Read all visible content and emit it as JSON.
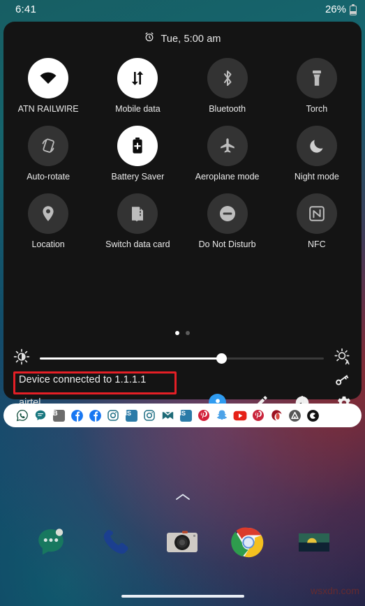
{
  "status_bar": {
    "time": "6:41",
    "battery_percent": "26%",
    "battery_icon": "battery-low-icon"
  },
  "quick_settings": {
    "alarm_icon": "alarm-clock-icon",
    "alarm_text": "Tue, 5:00 am",
    "tiles": [
      {
        "label": "ATN RAILWIRE",
        "icon": "wifi-icon",
        "active": true
      },
      {
        "label": "Mobile data",
        "icon": "mobile-data-icon",
        "active": true
      },
      {
        "label": "Bluetooth",
        "icon": "bluetooth-icon",
        "active": false
      },
      {
        "label": "Torch",
        "icon": "flashlight-icon",
        "active": false
      },
      {
        "label": "Auto-rotate",
        "icon": "auto-rotate-icon",
        "active": false
      },
      {
        "label": "Battery Saver",
        "icon": "battery-saver-icon",
        "active": true
      },
      {
        "label": "Aeroplane mode",
        "icon": "airplane-icon",
        "active": false
      },
      {
        "label": "Night mode",
        "icon": "moon-icon",
        "active": false
      },
      {
        "label": "Location",
        "icon": "location-pin-icon",
        "active": false
      },
      {
        "label": "Switch data card",
        "icon": "sim-card-icon",
        "active": false
      },
      {
        "label": "Do Not Disturb",
        "icon": "do-not-disturb-icon",
        "active": false
      },
      {
        "label": "NFC",
        "icon": "nfc-icon",
        "active": false
      }
    ],
    "pages": {
      "count": 2,
      "active_index": 0
    },
    "brightness": {
      "low_icon": "brightness-low-icon",
      "auto_icon": "brightness-auto-icon",
      "value_percent": 64
    },
    "footer": {
      "vpn_icon": "vpn-key-icon",
      "network_status": "Device connected to 1.1.1.1",
      "carrier": "airtel",
      "icons": [
        {
          "name": "user-avatar-icon",
          "label": "User"
        },
        {
          "name": "edit-pencil-icon",
          "label": "Edit"
        },
        {
          "name": "power-icon",
          "label": "Power"
        },
        {
          "name": "settings-gear-icon",
          "label": "Settings"
        }
      ]
    },
    "annotation": {
      "color": "#e41f26",
      "target": "Device connected to 1.1.1.1"
    }
  },
  "notification_strip": {
    "apps": [
      {
        "name": "whatsapp-icon",
        "color": "#0f4c3a"
      },
      {
        "name": "message-icon",
        "color": "#19777f"
      },
      {
        "name": "b-app-icon",
        "color": "#6b6b6b",
        "letter": "B"
      },
      {
        "name": "facebook-icon",
        "color": "#1877f2"
      },
      {
        "name": "facebook-icon-2",
        "color": "#1877f2"
      },
      {
        "name": "instagram-icon",
        "color": "#1f6f84"
      },
      {
        "name": "is-app-icon",
        "color": "#2b7ba8",
        "letter": "IS"
      },
      {
        "name": "instagram-icon-2",
        "color": "#1f6f84"
      },
      {
        "name": "mail-check-icon",
        "color": "#1f6b78"
      },
      {
        "name": "is-app-icon-2",
        "color": "#2b7ba8",
        "letter": "IS"
      },
      {
        "name": "pinterest-icon",
        "color": "#d3203a"
      },
      {
        "name": "snapchat-icon",
        "color": "#4da3e8"
      },
      {
        "name": "youtube-icon",
        "color": "#e62117"
      },
      {
        "name": "pinterest-icon-2",
        "color": "#c9243b"
      },
      {
        "name": "opera-red-icon",
        "color": "#9c1220"
      },
      {
        "name": "triangle-app-icon",
        "color": "#555555"
      },
      {
        "name": "circle-app-icon",
        "color": "#111111"
      }
    ]
  },
  "home_screen": {
    "chevron_icon": "chevron-up-icon",
    "dock_apps": [
      {
        "name": "messages-icon",
        "label": "Messages"
      },
      {
        "name": "phone-icon",
        "label": "Phone"
      },
      {
        "name": "camera-icon",
        "label": "Camera"
      },
      {
        "name": "chrome-icon",
        "label": "Chrome"
      },
      {
        "name": "gallery-icon",
        "label": "Gallery"
      }
    ],
    "nav_pill": "home-gesture-pill",
    "watermark": "wsxdn.com"
  }
}
